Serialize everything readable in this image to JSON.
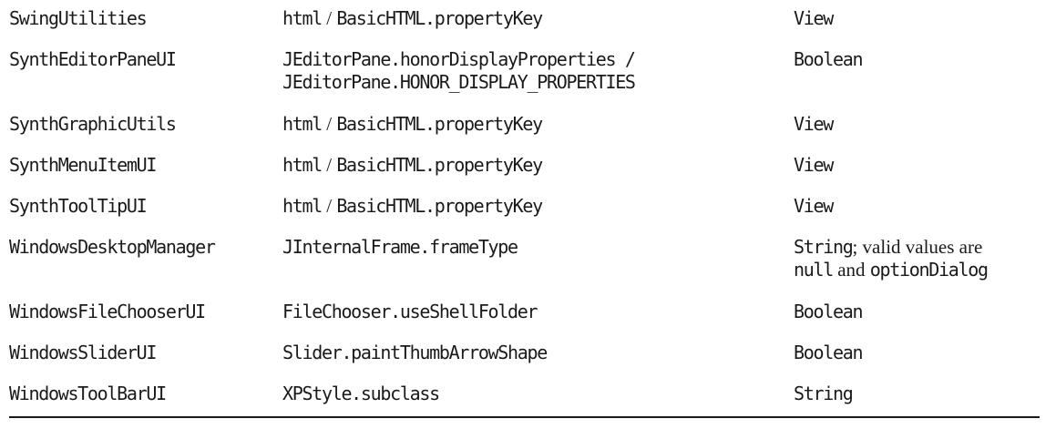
{
  "rows": [
    {
      "component": "SwingUtilities",
      "property_a": "html",
      "sep": " / ",
      "property_b": "BasicHTML.propertyKey",
      "type": "View"
    },
    {
      "component": "SynthEditorPaneUI",
      "property_line1": "JEditorPane.honorDisplayProperties /",
      "property_line2": "JEditorPane.HONOR_DISPLAY_PROPERTIES",
      "type": "Boolean"
    },
    {
      "component": "SynthGraphicUtils",
      "property_a": "html",
      "sep": " / ",
      "property_b": "BasicHTML.propertyKey",
      "type": "View"
    },
    {
      "component": "SynthMenuItemUI",
      "property_a": "html",
      "sep": " / ",
      "property_b": "BasicHTML.propertyKey",
      "type": "View"
    },
    {
      "component": "SynthToolTipUI",
      "property_a": "html",
      "sep": " / ",
      "property_b": "BasicHTML.propertyKey",
      "type": "View"
    },
    {
      "component": "WindowsDesktopManager",
      "property": "JInternalFrame.frameType",
      "type_code1": "String",
      "type_text1": "; valid values are",
      "type_code2": "null",
      "type_text2": " and ",
      "type_code3": "optionDialog"
    },
    {
      "component": "WindowsFileChooserUI",
      "property": "FileChooser.useShellFolder",
      "type": "Boolean"
    },
    {
      "component": "WindowsSliderUI",
      "property": "Slider.paintThumbArrowShape",
      "type": "Boolean"
    },
    {
      "component": "WindowsToolBarUI",
      "property": "XPStyle.subclass",
      "type": "String"
    }
  ]
}
